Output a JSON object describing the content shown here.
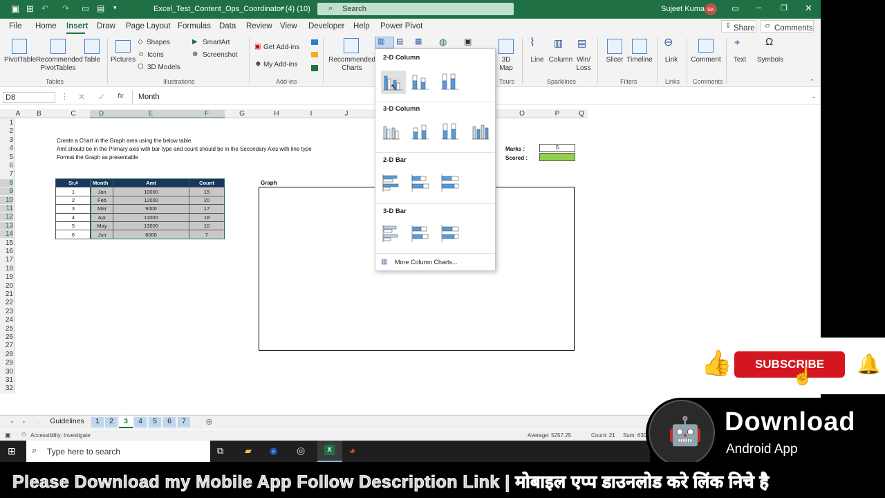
{
  "window": {
    "file_title": "Excel_Test_Content_Ops_Coordinator (4) (10)",
    "search_placeholder": "Search",
    "user_name": "Sujeet Kumar",
    "user_initials": "SK"
  },
  "menu": {
    "tabs": [
      "File",
      "Home",
      "Insert",
      "Draw",
      "Page Layout",
      "Formulas",
      "Data",
      "Review",
      "View",
      "Developer",
      "Help",
      "Power Pivot"
    ],
    "active": "Insert",
    "share_label": "Share",
    "comments_label": "Comments"
  },
  "ribbon": {
    "pivottable": "PivotTable",
    "recommended_pivot": "Recommended PivotTables",
    "table": "Table",
    "group_tables": "Tables",
    "pictures": "Pictures",
    "shapes": "Shapes",
    "icons": "Icons",
    "models": "3D Models",
    "smartart": "SmartArt",
    "screenshot": "Screenshot",
    "group_illustrations": "Illustrations",
    "get_addins": "Get Add-ins",
    "my_addins": "My Add-ins",
    "group_addins": "Add-ins",
    "recommended_charts": "Recommended Charts",
    "map3d": "3D Map",
    "group_tours": "Tours",
    "line": "Line",
    "column": "Column",
    "winloss": "Win/ Loss",
    "group_sparklines": "Sparklines",
    "slicer": "Slicer",
    "timeline": "Timeline",
    "group_filters": "Filters",
    "link": "Link",
    "group_links": "Links",
    "comment": "Comment",
    "group_comments": "Comments",
    "text": "Text",
    "symbols": "Symbols"
  },
  "formula_bar": {
    "name_box": "D8",
    "fx": "fx",
    "content": "Month"
  },
  "columns": [
    "A",
    "B",
    "C",
    "D",
    "E",
    "F",
    "G",
    "H",
    "I",
    "J",
    "K",
    "L",
    "M",
    "N",
    "O",
    "P",
    "Q"
  ],
  "rows": [
    "1",
    "2",
    "3",
    "4",
    "5",
    "6",
    "7",
    "8",
    "9",
    "10",
    "11",
    "12",
    "13",
    "14",
    "15",
    "16",
    "17",
    "18",
    "19",
    "20",
    "21",
    "22",
    "23",
    "24",
    "25",
    "26",
    "27",
    "28",
    "29",
    "30",
    "31",
    "32"
  ],
  "instructions": [
    "Create a Chart in the Graph area using the below table.",
    "Amt should be in the Primary axis with bar type and count should be in the Secondary Axis with line type",
    "Format the Graph as presentable"
  ],
  "table": {
    "headers": [
      "Sr.#",
      "Month",
      "Amt",
      "Count"
    ],
    "rows": [
      [
        "1",
        "Jan",
        "10000",
        "15"
      ],
      [
        "2",
        "Feb",
        "12000",
        "20"
      ],
      [
        "3",
        "Mar",
        "9000",
        "17"
      ],
      [
        "4",
        "Apr",
        "11000",
        "18"
      ],
      [
        "5",
        "May",
        "13000",
        "10"
      ],
      [
        "6",
        "Jun",
        "8000",
        "7"
      ]
    ]
  },
  "graph_label": "Graph",
  "marks": {
    "marks_label": "Marks :",
    "marks_value": "5",
    "scored_label": "Scored :"
  },
  "chart_menu": {
    "section_2d_column": "2-D Column",
    "section_3d_column": "3-D Column",
    "section_2d_bar": "2-D Bar",
    "section_3d_bar": "3-D Bar",
    "more": "More Column Charts..."
  },
  "sheet_tabs": [
    "Guidelines",
    "1",
    "2",
    "3",
    "4",
    "5",
    "6",
    "7"
  ],
  "active_sheet": "3",
  "status_bar": {
    "accessibility": "Accessibility: Investigate",
    "average": "Average: 5257.25",
    "count": "Count: 21",
    "sum": "Sum: 630"
  },
  "taskbar": {
    "search_placeholder": "Type here to search"
  },
  "overlay": {
    "subscribe": "SUBSCRIBE",
    "download": "Download",
    "android_app": "Android App",
    "banner_text": "Please Download my Mobile App Follow Description Link | मोबाइल एप्प डाउनलोड करे लिंक निचे है"
  },
  "colors": {
    "excel_green": "#1f7145",
    "header_navy": "#17375e",
    "scored_green": "#92d050",
    "subscribe_red": "#d3161f"
  }
}
